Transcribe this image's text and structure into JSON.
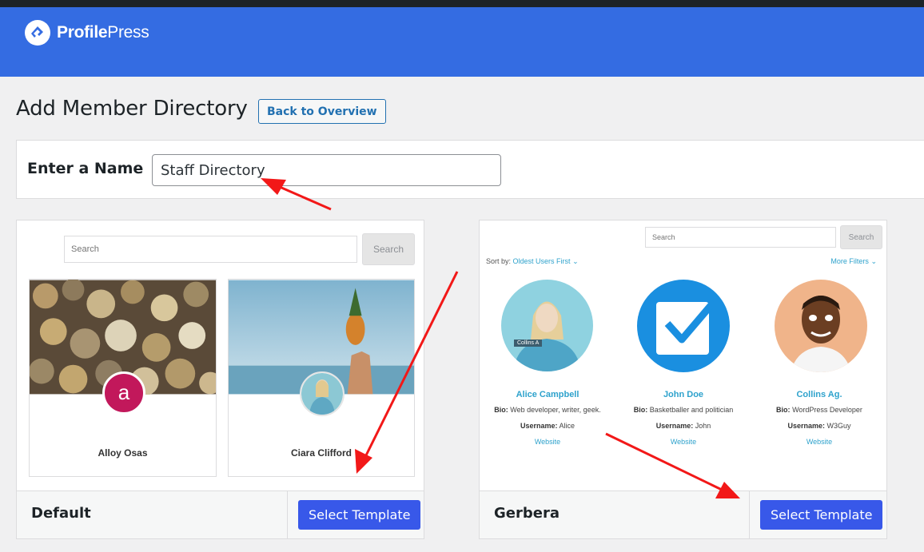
{
  "brand": {
    "name_bold": "Profile",
    "name_light": "Press"
  },
  "page": {
    "title": "Add Member Directory",
    "back_label": "Back to Overview"
  },
  "name_field": {
    "label": "Enter a Name",
    "value": "Staff Directory"
  },
  "templates": [
    {
      "name": "Default",
      "select_label": "Select Template",
      "preview": {
        "search_placeholder": "Search",
        "search_button": "Search",
        "members": [
          {
            "name": "Alloy Osas",
            "avatar_letter": "a"
          },
          {
            "name": "Ciara Clifford"
          }
        ]
      }
    },
    {
      "name": "Gerbera",
      "select_label": "Select Template",
      "preview": {
        "search_placeholder": "Search",
        "search_button": "Search",
        "sort_label": "Sort by:",
        "sort_value": "Oldest Users First",
        "more_filters": "More Filters",
        "members": [
          {
            "name": "Alice Campbell",
            "bio_label": "Bio:",
            "bio": "Web developer, writer, geek.",
            "username_label": "Username:",
            "username": "Alice",
            "link": "Website",
            "tag": "Collins A"
          },
          {
            "name": "John Doe",
            "bio_label": "Bio:",
            "bio": "Basketballer and politician",
            "username_label": "Username:",
            "username": "John",
            "link": "Website"
          },
          {
            "name": "Collins Ag.",
            "bio_label": "Bio:",
            "bio": "WordPress Developer",
            "username_label": "Username:",
            "username": "W3Guy",
            "link": "Website"
          }
        ]
      }
    }
  ],
  "colors": {
    "header": "#346ce2",
    "button": "#3858e9",
    "link": "#2ea2cc",
    "arrow": "#f21818",
    "avatar_letter_bg": "#c2185b"
  }
}
